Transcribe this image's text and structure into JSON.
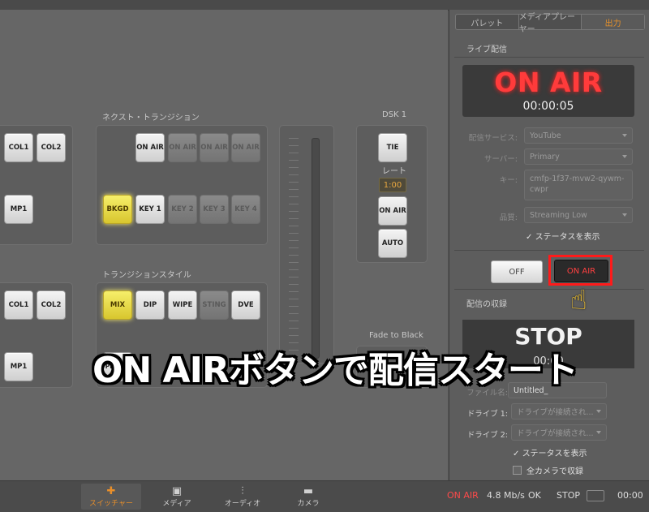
{
  "sidebar": {
    "tabs": [
      "パレット",
      "メディアプレーヤー",
      "出力"
    ],
    "active_tab": "出力",
    "live_header": "ライブ配信",
    "onair_display": "ON AIR",
    "timer": "00:00:05",
    "service_label": "配信サービス:",
    "service_value": "YouTube",
    "server_label": "サーバー:",
    "server_value": "Primary",
    "key_label": "キー:",
    "key_value": "cmfp-1f37-mvw2-qywm-cwpr",
    "quality_label": "品質:",
    "quality_value": "Streaming Low",
    "show_status": "ステータスを表示",
    "off_label": "OFF",
    "onair_button": "ON AIR",
    "record_header": "配信の収録",
    "stop_display": "STOP",
    "stop_time": "00:00",
    "filename_label": "ファイル名:",
    "filename_value": "Untitled_",
    "drive1_label": "ドライブ 1:",
    "drive1_value": "ドライブが接続され...",
    "drive2_label": "ドライブ 2:",
    "drive2_value": "ドライブが接続され...",
    "show_status2": "ステータスを表示",
    "record_all": "全カメラで収録"
  },
  "switcher": {
    "next_transition": "ネクスト・トランジション",
    "transition_style": "トランジションスタイル",
    "dsk": "DSK 1",
    "rate_label": "レート",
    "rate_value": "1:00",
    "fade_to_black": "Fade to Black",
    "buttons": {
      "col1_a": "COL1",
      "col2_a": "COL2",
      "mp1_a": "MP1",
      "col1_b": "COL1",
      "col2_b": "COL2",
      "mp1_b": "MP1",
      "onair1": "ON AIR",
      "onair2": "ON AIR",
      "onair3": "ON AIR",
      "onair4": "ON AIR",
      "bkgd": "BKGD",
      "key1": "KEY 1",
      "key2": "KEY 2",
      "key3": "KEY 3",
      "key4": "KEY 4",
      "mix": "MIX",
      "dip": "DIP",
      "wipe": "WIPE",
      "sting": "STING",
      "dve": "DVE",
      "tie": "TIE",
      "dsk_onair": "ON AIR",
      "auto": "AUTO",
      "prev_trans": "PR TRA"
    }
  },
  "bottom": {
    "nav": [
      "スイッチャー",
      "メディア",
      "オーディオ",
      "カメラ"
    ],
    "onair_status": "ON AIR",
    "bitrate": "4.8 Mb/s",
    "ok": "OK",
    "stop": "STOP",
    "time": "00:00"
  },
  "caption": "ON AIRボタンで配信スタート"
}
